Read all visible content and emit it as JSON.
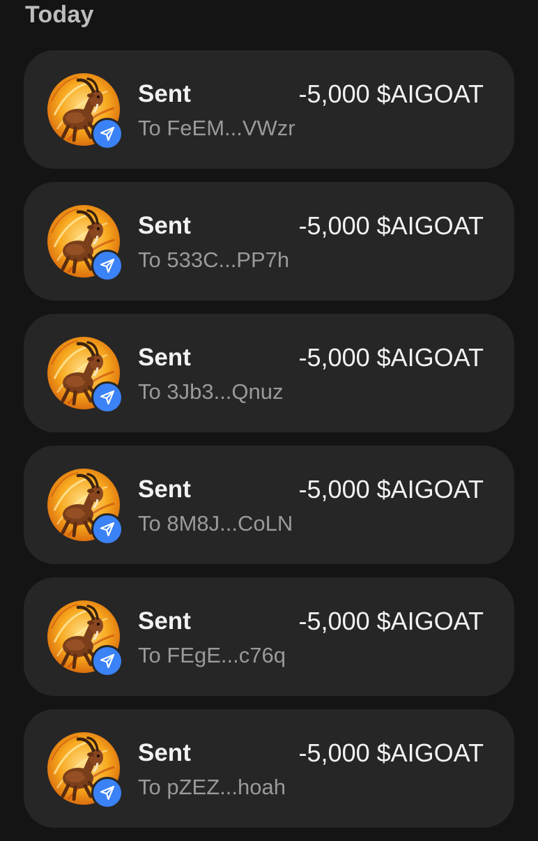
{
  "section": {
    "title": "Today"
  },
  "colors": {
    "background": "#141414",
    "card": "#262626",
    "badge_blue": "#3b82f6",
    "avatar_orange": "#f59a1c"
  },
  "icons": {
    "avatar": "goat-token-avatar-icon",
    "badge": "send-arrow-icon"
  },
  "transactions": [
    {
      "type": "Sent",
      "amount": "-5,000 $AIGOAT",
      "recipient": "To FeEM...VWzr"
    },
    {
      "type": "Sent",
      "amount": "-5,000 $AIGOAT",
      "recipient": "To 533C...PP7h"
    },
    {
      "type": "Sent",
      "amount": "-5,000 $AIGOAT",
      "recipient": "To 3Jb3...Qnuz"
    },
    {
      "type": "Sent",
      "amount": "-5,000 $AIGOAT",
      "recipient": "To 8M8J...CoLN"
    },
    {
      "type": "Sent",
      "amount": "-5,000 $AIGOAT",
      "recipient": "To FEgE...c76q"
    },
    {
      "type": "Sent",
      "amount": "-5,000 $AIGOAT",
      "recipient": "To pZEZ...hoah"
    }
  ]
}
